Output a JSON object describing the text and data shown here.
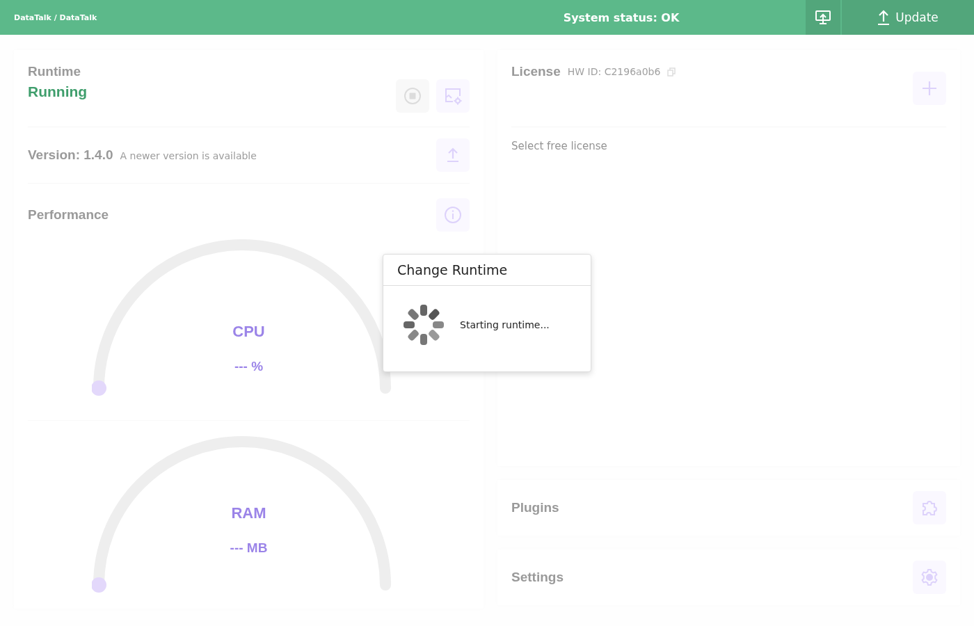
{
  "header": {
    "breadcrumb": "DataTalk / DataTalk",
    "status": "System status: OK",
    "update_label": "Update"
  },
  "runtime": {
    "title": "Runtime",
    "state": "Running",
    "actions": [
      {
        "kind": "stop",
        "disabled": true
      },
      {
        "kind": "configure",
        "disabled": false
      }
    ]
  },
  "version": {
    "label": "Version: 1.4.0",
    "note": "A newer version is available"
  },
  "performance": {
    "title": "Performance",
    "gauges": [
      {
        "label": "CPU",
        "reading": "--- %",
        "level": 0
      },
      {
        "label": "RAM",
        "reading": "--- MB",
        "level": 0
      }
    ]
  },
  "license": {
    "title": "License",
    "hw_id": "HW ID: C2196a0b6",
    "option": "Select free license"
  },
  "plugins": {
    "title": "Plugins"
  },
  "settings": {
    "title": "Settings"
  },
  "dialog": {
    "title": "Change Runtime",
    "message": "Starting runtime..."
  }
}
